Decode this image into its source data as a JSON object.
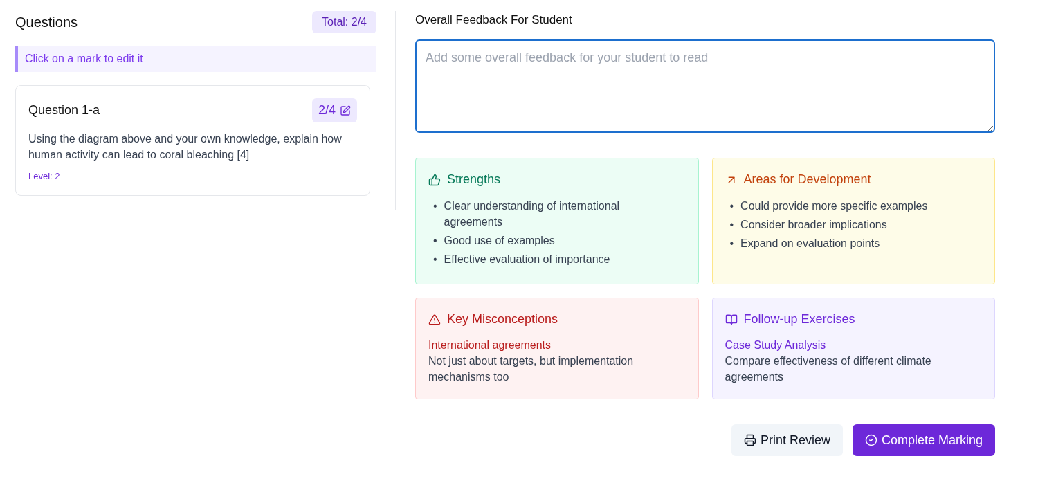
{
  "questions_panel": {
    "title": "Questions",
    "total": "Total: 2/4",
    "hint": "Click on a mark to edit it",
    "questions": [
      {
        "title": "Question 1-a",
        "mark": "2/4",
        "text": "Using the diagram above and your own knowledge, explain how human activity can lead to coral bleaching [4]",
        "level": "Level: 2"
      }
    ]
  },
  "feedback": {
    "label": "Overall Feedback For Student",
    "placeholder": "Add some overall feedback for your student to read"
  },
  "cards": [
    {
      "kind": "strengths",
      "title": "Strengths",
      "marker": "•",
      "items": [
        "Clear understanding of international agreements",
        "Good use of examples",
        "Effective evaluation of importance"
      ]
    },
    {
      "kind": "development",
      "title": "Areas for Development",
      "marker": "•",
      "items": [
        "Could provide more specific examples",
        "Consider broader implications",
        "Expand on evaluation points"
      ]
    },
    {
      "kind": "misconceptions",
      "title": "Key Misconceptions",
      "entries": [
        {
          "heading": "International agreements",
          "text": "Not just about targets, but implementation mechanisms too"
        }
      ]
    },
    {
      "kind": "exercises",
      "title": "Follow-up Exercises",
      "entries": [
        {
          "heading": "Case Study Analysis",
          "text": "Compare effectiveness of different climate agreements"
        }
      ]
    }
  ],
  "buttons": [
    {
      "kind": "print",
      "label": "Print Review"
    },
    {
      "kind": "complete",
      "label": "Complete Marking"
    }
  ]
}
